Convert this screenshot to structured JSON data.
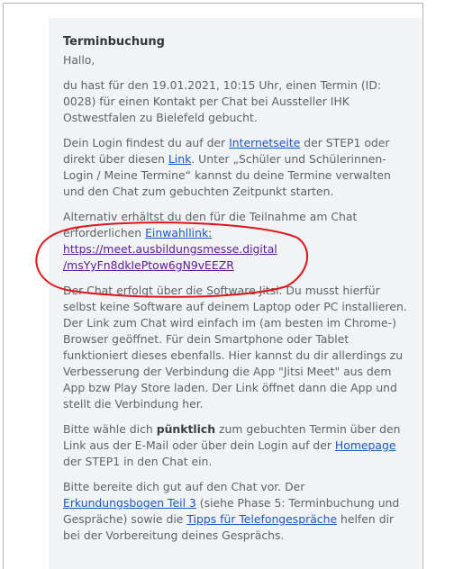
{
  "email": {
    "title": "Terminbuchung",
    "greeting": "Hallo,",
    "p1": "du hast für den 19.01.2021, 10:15 Uhr, einen Termin (ID: 0028) für einen Kontakt per Chat bei Aussteller IHK Ostwestfalen zu Bielefeld gebucht.",
    "p2": {
      "t1": "Dein Login findest du auf der ",
      "link_website": "Internetseite",
      "t2": " der STEP1 oder direkt über diesen ",
      "link_link": "Link",
      "t3": ". Unter „Schüler und Schülerinnen-Login / Meine Termine“ kannst du deine Termine verwalten und den Chat zum gebuchten Zeitpunkt starten."
    },
    "p3": {
      "t1": "Alternativ erhältst du den für die Teilnahme am Chat erforderlichen ",
      "link_dialin": "Einwahllink:",
      "url_line1": "https://meet.ausbildungsmesse.digital",
      "url_line2": "/msYyFn8dkIePtow6gN9vEEZR"
    },
    "p4": "Der Chat erfolgt über die Software Jitsi. Du musst hierfür selbst keine Software auf deinem Laptop oder PC installieren. Der Link zum Chat wird einfach im (am besten im Chrome-) Browser geöffnet. Für dein Smartphone oder Tablet funktioniert dieses ebenfalls. Hier kannst du dir allerdings zu Verbesserung der Verbindung die App \"Jitsi Meet\" aus dem App bzw Play Store laden. Der Link öffnet dann die App und stellt die Verbindung her.",
    "p5": {
      "t1": "Bitte wähle dich ",
      "bold": "pünktlich",
      "t2": " zum gebuchten Termin über den Link aus der E-Mail oder über dein Login auf der ",
      "link_homepage": "Homepage",
      "t3": " der STEP1 in den Chat ein."
    },
    "p6": {
      "t1": "Bitte bereite dich gut auf den Chat vor. Der ",
      "link_bogen": "Erkundungsbogen Teil 3",
      "t2": " (siehe Phase 5: Terminbuchung und Gespräche) sowie die ",
      "link_tips": "Tipps für Telefongespräche",
      "t3": " helfen dir bei der Vorbereitung deines Gesprächs."
    }
  },
  "annotation": {
    "color": "#e0141c"
  }
}
